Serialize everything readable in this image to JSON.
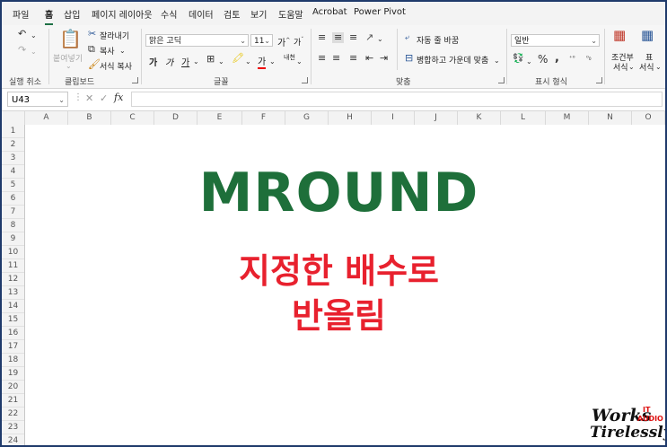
{
  "menu": {
    "tabs": [
      {
        "label": "파일",
        "active": false
      },
      {
        "label": "홈",
        "active": true
      },
      {
        "label": "삽입",
        "active": false
      },
      {
        "label": "페이지 레이아웃",
        "active": false
      },
      {
        "label": "수식",
        "active": false
      },
      {
        "label": "데이터",
        "active": false
      },
      {
        "label": "검토",
        "active": false
      },
      {
        "label": "보기",
        "active": false
      },
      {
        "label": "도움말",
        "active": false
      },
      {
        "label": "Acrobat",
        "active": false
      },
      {
        "label": "Power Pivot",
        "active": false
      }
    ]
  },
  "ribbon": {
    "undo": {
      "group_label": "실행 취소"
    },
    "clipboard": {
      "paste_label": "붙여넣기",
      "cut_label": "잘라내기",
      "copy_label": "복사",
      "format_painter_label": "서식 복사",
      "group_label": "클립보드"
    },
    "font": {
      "font_name": "맑은 고딕",
      "font_size": "11",
      "grow_label": "가",
      "shrink_label": "가",
      "bold": "가",
      "italic": "가",
      "underline": "가",
      "font_color_label": "가",
      "phonetic_label": "내천",
      "group_label": "글꼴"
    },
    "alignment": {
      "wrap_label": "자동 줄 바꿈",
      "merge_label": "병합하고 가운데 맞춤",
      "group_label": "맞춤"
    },
    "number": {
      "format": "일반",
      "group_label": "표시 형식"
    },
    "styles": {
      "conditional_label_1": "조건부",
      "conditional_label_2": "서식",
      "table_label_1": "표",
      "table_label_2": "서식"
    }
  },
  "formula_bar": {
    "name_box": "U43",
    "fx_label": "fx",
    "value": ""
  },
  "sheet": {
    "columns": [
      "A",
      "B",
      "C",
      "D",
      "E",
      "F",
      "G",
      "H",
      "I",
      "J",
      "K",
      "L",
      "M",
      "N",
      "O"
    ],
    "rows": [
      "1",
      "2",
      "3",
      "4",
      "5",
      "6",
      "7",
      "8",
      "9",
      "10",
      "11",
      "12",
      "13",
      "14",
      "15",
      "16",
      "17",
      "18",
      "19",
      "20",
      "21",
      "22",
      "23",
      "24"
    ],
    "title": "MROUND",
    "subtitle_line1": "지정한 배수로",
    "subtitle_line2": "반올림"
  },
  "logo": {
    "word1": "Works",
    "tag1": "IT",
    "tag2": "AUDIO",
    "word2": "Tirelessly"
  },
  "colors": {
    "accent": "#1e7145",
    "title": "#1e6f3a",
    "subtitle": "#e8212e",
    "frame": "#1f3a6b"
  }
}
